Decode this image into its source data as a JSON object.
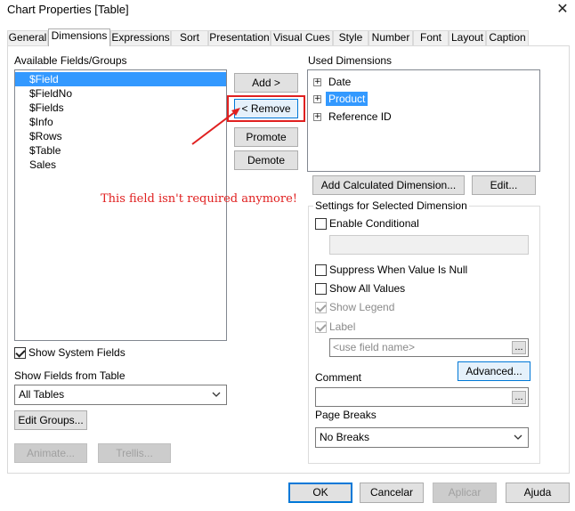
{
  "window": {
    "title": "Chart Properties [Table]",
    "close_icon": "close-icon"
  },
  "tabs": [
    {
      "label": "General"
    },
    {
      "label": "Dimensions"
    },
    {
      "label": "Expressions"
    },
    {
      "label": "Sort"
    },
    {
      "label": "Presentation"
    },
    {
      "label": "Visual Cues"
    },
    {
      "label": "Style"
    },
    {
      "label": "Number"
    },
    {
      "label": "Font"
    },
    {
      "label": "Layout"
    },
    {
      "label": "Caption"
    }
  ],
  "active_tab": "Dimensions",
  "available": {
    "label": "Available Fields/Groups",
    "items": [
      "$Field",
      "$FieldNo",
      "$Fields",
      "$Info",
      "$Rows",
      "$Table",
      "Sales"
    ],
    "selected_index": 0,
    "show_system_fields": "Show System Fields",
    "show_fields_from_table_label": "Show Fields from Table",
    "table_select_value": "All Tables",
    "edit_groups": "Edit Groups...",
    "animate": "Animate...",
    "trellis": "Trellis..."
  },
  "middle_buttons": {
    "add": "Add >",
    "remove": "< Remove",
    "promote": "Promote",
    "demote": "Demote"
  },
  "annotation": {
    "text": "This field isn't required anymore!",
    "color": "#e02020"
  },
  "used": {
    "label": "Used Dimensions",
    "items": [
      "Date",
      "Product",
      "Reference ID"
    ],
    "selected_index": 1,
    "add_calculated": "Add Calculated Dimension...",
    "edit": "Edit..."
  },
  "settings": {
    "title": "Settings for Selected Dimension",
    "enable_conditional": "Enable Conditional",
    "suppress_null": "Suppress When Value Is Null",
    "show_all_values": "Show All Values",
    "show_legend": "Show Legend",
    "label": "Label",
    "label_placeholder": "<use field name>",
    "advanced": "Advanced...",
    "comment": "Comment",
    "page_breaks": "Page Breaks",
    "page_breaks_value": "No Breaks"
  },
  "footer": {
    "ok": "OK",
    "cancel": "Cancelar",
    "apply": "Aplicar",
    "help": "Ajuda"
  },
  "colors": {
    "selection": "#3399ff",
    "annotation": "#e02020",
    "focus": "#0078d7"
  }
}
